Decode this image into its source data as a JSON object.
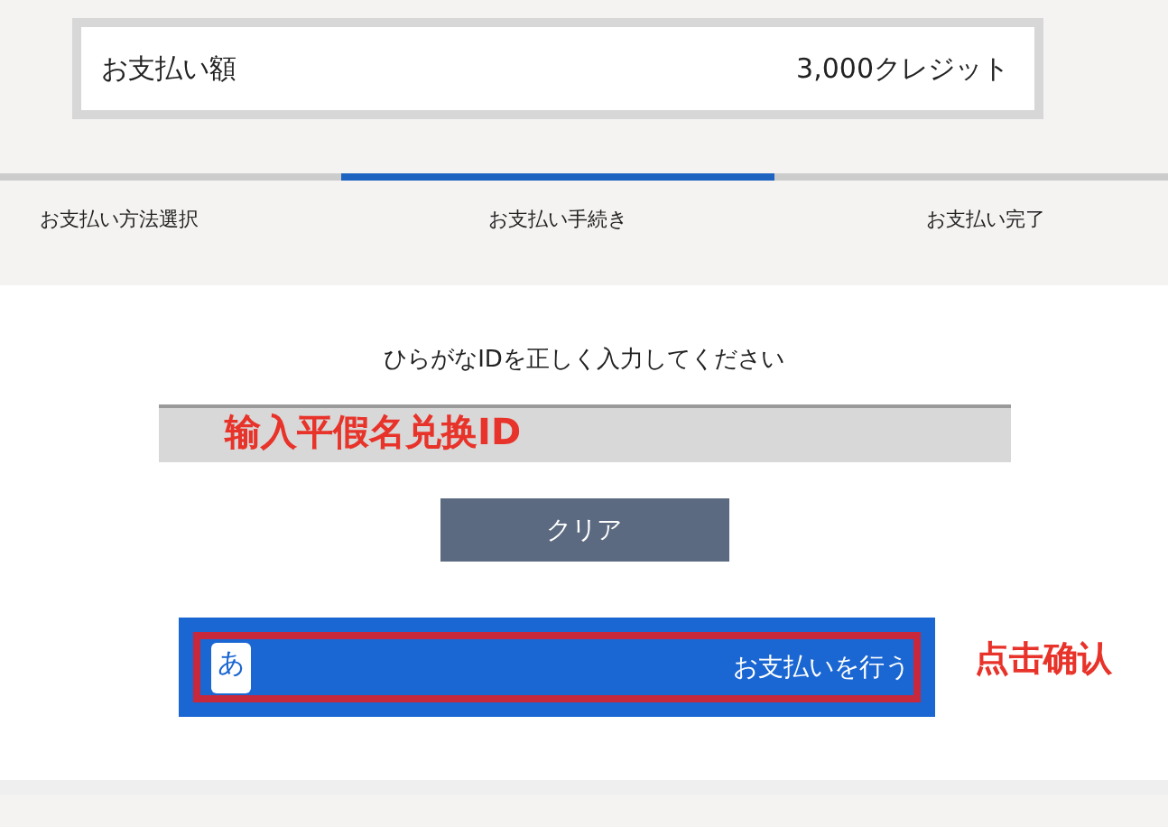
{
  "amount": {
    "label": "お支払い額",
    "value": "3,000クレジット"
  },
  "steps": [
    {
      "label": "お支払い方法選択",
      "selected": false
    },
    {
      "label": "お支払い手続き",
      "selected": true
    },
    {
      "label": "お支払い完了",
      "selected": false
    }
  ],
  "instruction": "ひらがなIDを正しく入力してください",
  "id_field": {
    "annotation": "输入平假名兑换ID"
  },
  "clear_button": "クリア",
  "pay_button": {
    "icon_glyph": "あ",
    "label": "お支払いを行う",
    "highlighted": true,
    "annotation": "点击确认"
  }
}
